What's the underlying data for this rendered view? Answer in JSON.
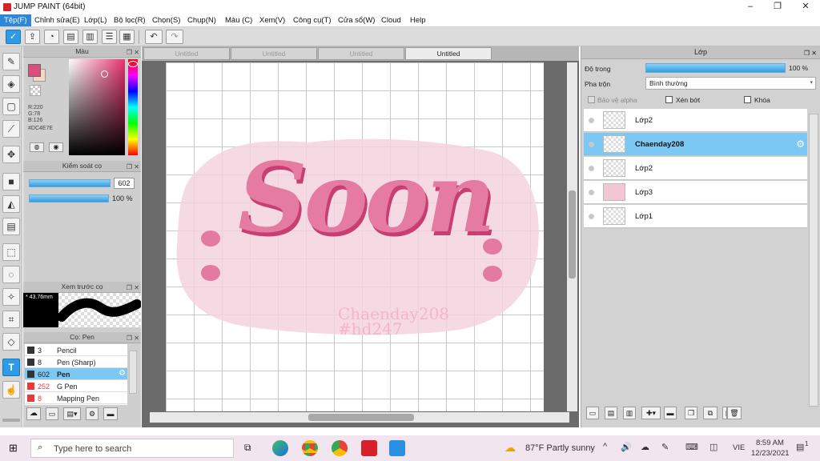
{
  "window": {
    "title": "JUMP PAINT (64bit)",
    "min_glyph": "–",
    "max_glyph": "❐",
    "close_glyph": "✕"
  },
  "menu": [
    "Tệp(F)",
    "Chỉnh sửa(E)",
    "Lớp(L)",
    "Bộ lọc(R)",
    "Chọn(S)",
    "Chụp(N)",
    "Màu (C)",
    "Xem(V)",
    "Công cụ(T)",
    "Cửa sổ(W)",
    "Cloud",
    "Help"
  ],
  "color_panel": {
    "title": "Màu",
    "r": "R:220",
    "g": "G:78",
    "b": "B:126",
    "hex": "#DC4E7E",
    "main_color": "#DC4E7E",
    "sub_color": "#F7D7C4"
  },
  "brush_control": {
    "title": "Kiểm soát cọ",
    "size": "602",
    "opacity": "100 %",
    "opacity_fraction": 1.0
  },
  "preview": {
    "title": "Xem trước cọ",
    "size_text": "* 43.76mm"
  },
  "brush_list": {
    "title": "Cọ: Pen",
    "items": [
      {
        "num": "3",
        "name": "Pencil",
        "color": "#333333",
        "selected": false
      },
      {
        "num": "8",
        "name": "Pen (Sharp)",
        "color": "#333333",
        "selected": false
      },
      {
        "num": "602",
        "name": "Pen",
        "color": "#333333",
        "selected": true
      },
      {
        "num": "252",
        "name": "G Pen",
        "color": "#e83a3a",
        "selected": false
      },
      {
        "num": "8",
        "name": "Mapping Pen",
        "color": "#e83a3a",
        "selected": false
      }
    ]
  },
  "tabs": [
    "Untitled",
    "Untitled",
    "Untitled",
    "Untitled"
  ],
  "artwork": {
    "main_text": "Soon",
    "watermark_line1": "Chaenday208",
    "watermark_line2": "#hd247"
  },
  "layer_panel": {
    "title": "Lớp",
    "opacity_label": "Độ trong",
    "opacity_value": "100 %",
    "opacity_fraction": 1.0,
    "blend_label": "Pha trộn",
    "blend_value": "Bình thường",
    "protect_alpha": "Bảo vệ alpha",
    "clipping": "Xén bớt",
    "lock": "Khóa",
    "layers": [
      {
        "name": "Lớp2",
        "selected": false
      },
      {
        "name": "Chaenday208",
        "selected": true
      },
      {
        "name": "Lớp2",
        "selected": false
      },
      {
        "name": "Lớp3",
        "selected": false
      },
      {
        "name": "Lớp1",
        "selected": false
      }
    ]
  },
  "taskbar": {
    "search_placeholder": "Type here to search",
    "weather": "87°F  Partly sunny",
    "lang": "VIE",
    "time": "8:59 AM",
    "date": "12/23/2021",
    "notifications": "1"
  }
}
